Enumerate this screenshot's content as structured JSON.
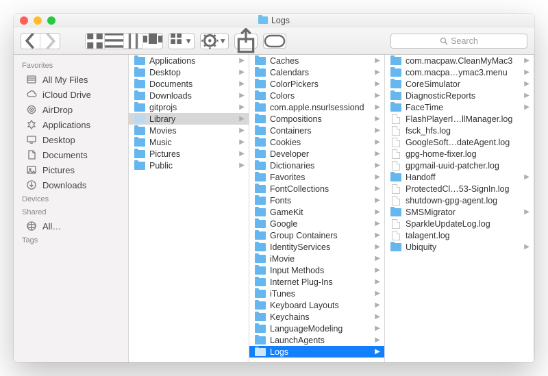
{
  "window": {
    "title": "Logs"
  },
  "toolbar": {
    "search_placeholder": "Search"
  },
  "sidebar": {
    "sections": [
      {
        "header": "Favorites",
        "items": [
          {
            "icon": "all-my-files",
            "label": "All My Files"
          },
          {
            "icon": "cloud",
            "label": "iCloud Drive"
          },
          {
            "icon": "airdrop",
            "label": "AirDrop"
          },
          {
            "icon": "apps",
            "label": "Applications"
          },
          {
            "icon": "desktop",
            "label": "Desktop"
          },
          {
            "icon": "documents",
            "label": "Documents"
          },
          {
            "icon": "pictures",
            "label": "Pictures"
          },
          {
            "icon": "downloads",
            "label": "Downloads"
          }
        ]
      },
      {
        "header": "Devices",
        "items": []
      },
      {
        "header": "Shared",
        "items": [
          {
            "icon": "network",
            "label": "All…"
          }
        ]
      },
      {
        "header": "Tags",
        "items": []
      }
    ]
  },
  "columns": [
    {
      "items": [
        {
          "type": "folder",
          "label": "Applications",
          "arrow": true
        },
        {
          "type": "folder",
          "label": "Desktop",
          "arrow": true
        },
        {
          "type": "folder",
          "label": "Documents",
          "arrow": true
        },
        {
          "type": "folder",
          "label": "Downloads",
          "arrow": true
        },
        {
          "type": "folder",
          "label": "gitprojs",
          "arrow": true
        },
        {
          "type": "folder-faded",
          "label": "Library",
          "arrow": true,
          "selected": "grey"
        },
        {
          "type": "folder",
          "label": "Movies",
          "arrow": true
        },
        {
          "type": "folder",
          "label": "Music",
          "arrow": true
        },
        {
          "type": "folder",
          "label": "Pictures",
          "arrow": true
        },
        {
          "type": "folder",
          "label": "Public",
          "arrow": true
        }
      ]
    },
    {
      "items": [
        {
          "type": "folder",
          "label": "Caches",
          "arrow": true
        },
        {
          "type": "folder",
          "label": "Calendars",
          "arrow": true
        },
        {
          "type": "folder",
          "label": "ColorPickers",
          "arrow": true
        },
        {
          "type": "folder",
          "label": "Colors",
          "arrow": true
        },
        {
          "type": "folder",
          "label": "com.apple.nsurlsessiond",
          "arrow": true
        },
        {
          "type": "folder",
          "label": "Compositions",
          "arrow": true
        },
        {
          "type": "folder",
          "label": "Containers",
          "arrow": true
        },
        {
          "type": "folder",
          "label": "Cookies",
          "arrow": true
        },
        {
          "type": "folder",
          "label": "Developer",
          "arrow": true
        },
        {
          "type": "folder",
          "label": "Dictionaries",
          "arrow": true
        },
        {
          "type": "folder",
          "label": "Favorites",
          "arrow": true
        },
        {
          "type": "folder",
          "label": "FontCollections",
          "arrow": true
        },
        {
          "type": "folder",
          "label": "Fonts",
          "arrow": true
        },
        {
          "type": "folder",
          "label": "GameKit",
          "arrow": true
        },
        {
          "type": "folder",
          "label": "Google",
          "arrow": true
        },
        {
          "type": "folder",
          "label": "Group Containers",
          "arrow": true
        },
        {
          "type": "folder",
          "label": "IdentityServices",
          "arrow": true
        },
        {
          "type": "folder",
          "label": "iMovie",
          "arrow": true
        },
        {
          "type": "folder",
          "label": "Input Methods",
          "arrow": true
        },
        {
          "type": "folder",
          "label": "Internet Plug-Ins",
          "arrow": true
        },
        {
          "type": "folder",
          "label": "iTunes",
          "arrow": true
        },
        {
          "type": "folder",
          "label": "Keyboard Layouts",
          "arrow": true
        },
        {
          "type": "folder",
          "label": "Keychains",
          "arrow": true
        },
        {
          "type": "folder",
          "label": "LanguageModeling",
          "arrow": true
        },
        {
          "type": "folder",
          "label": "LaunchAgents",
          "arrow": true
        },
        {
          "type": "folder",
          "label": "Logs",
          "arrow": true,
          "selected": "blue"
        }
      ]
    },
    {
      "items": [
        {
          "type": "folder",
          "label": "com.macpaw.CleanMyMac3",
          "arrow": true
        },
        {
          "type": "folder",
          "label": "com.macpa…ymac3.menu",
          "arrow": true
        },
        {
          "type": "folder",
          "label": "CoreSimulator",
          "arrow": true
        },
        {
          "type": "folder",
          "label": "DiagnosticReports",
          "arrow": true
        },
        {
          "type": "folder",
          "label": "FaceTime",
          "arrow": true
        },
        {
          "type": "doc",
          "label": "FlashPlayerI…llManager.log"
        },
        {
          "type": "doc",
          "label": "fsck_hfs.log"
        },
        {
          "type": "doc",
          "label": "GoogleSoft…dateAgent.log"
        },
        {
          "type": "doc",
          "label": "gpg-home-fixer.log"
        },
        {
          "type": "doc",
          "label": "gpgmail-uuid-patcher.log"
        },
        {
          "type": "folder",
          "label": "Handoff",
          "arrow": true
        },
        {
          "type": "doc",
          "label": "ProtectedCl…53-SignIn.log"
        },
        {
          "type": "doc",
          "label": "shutdown-gpg-agent.log"
        },
        {
          "type": "folder",
          "label": "SMSMigrator",
          "arrow": true
        },
        {
          "type": "doc",
          "label": "SparkleUpdateLog.log"
        },
        {
          "type": "doc",
          "label": "talagent.log"
        },
        {
          "type": "folder",
          "label": "Ubiquity",
          "arrow": true
        }
      ]
    }
  ]
}
